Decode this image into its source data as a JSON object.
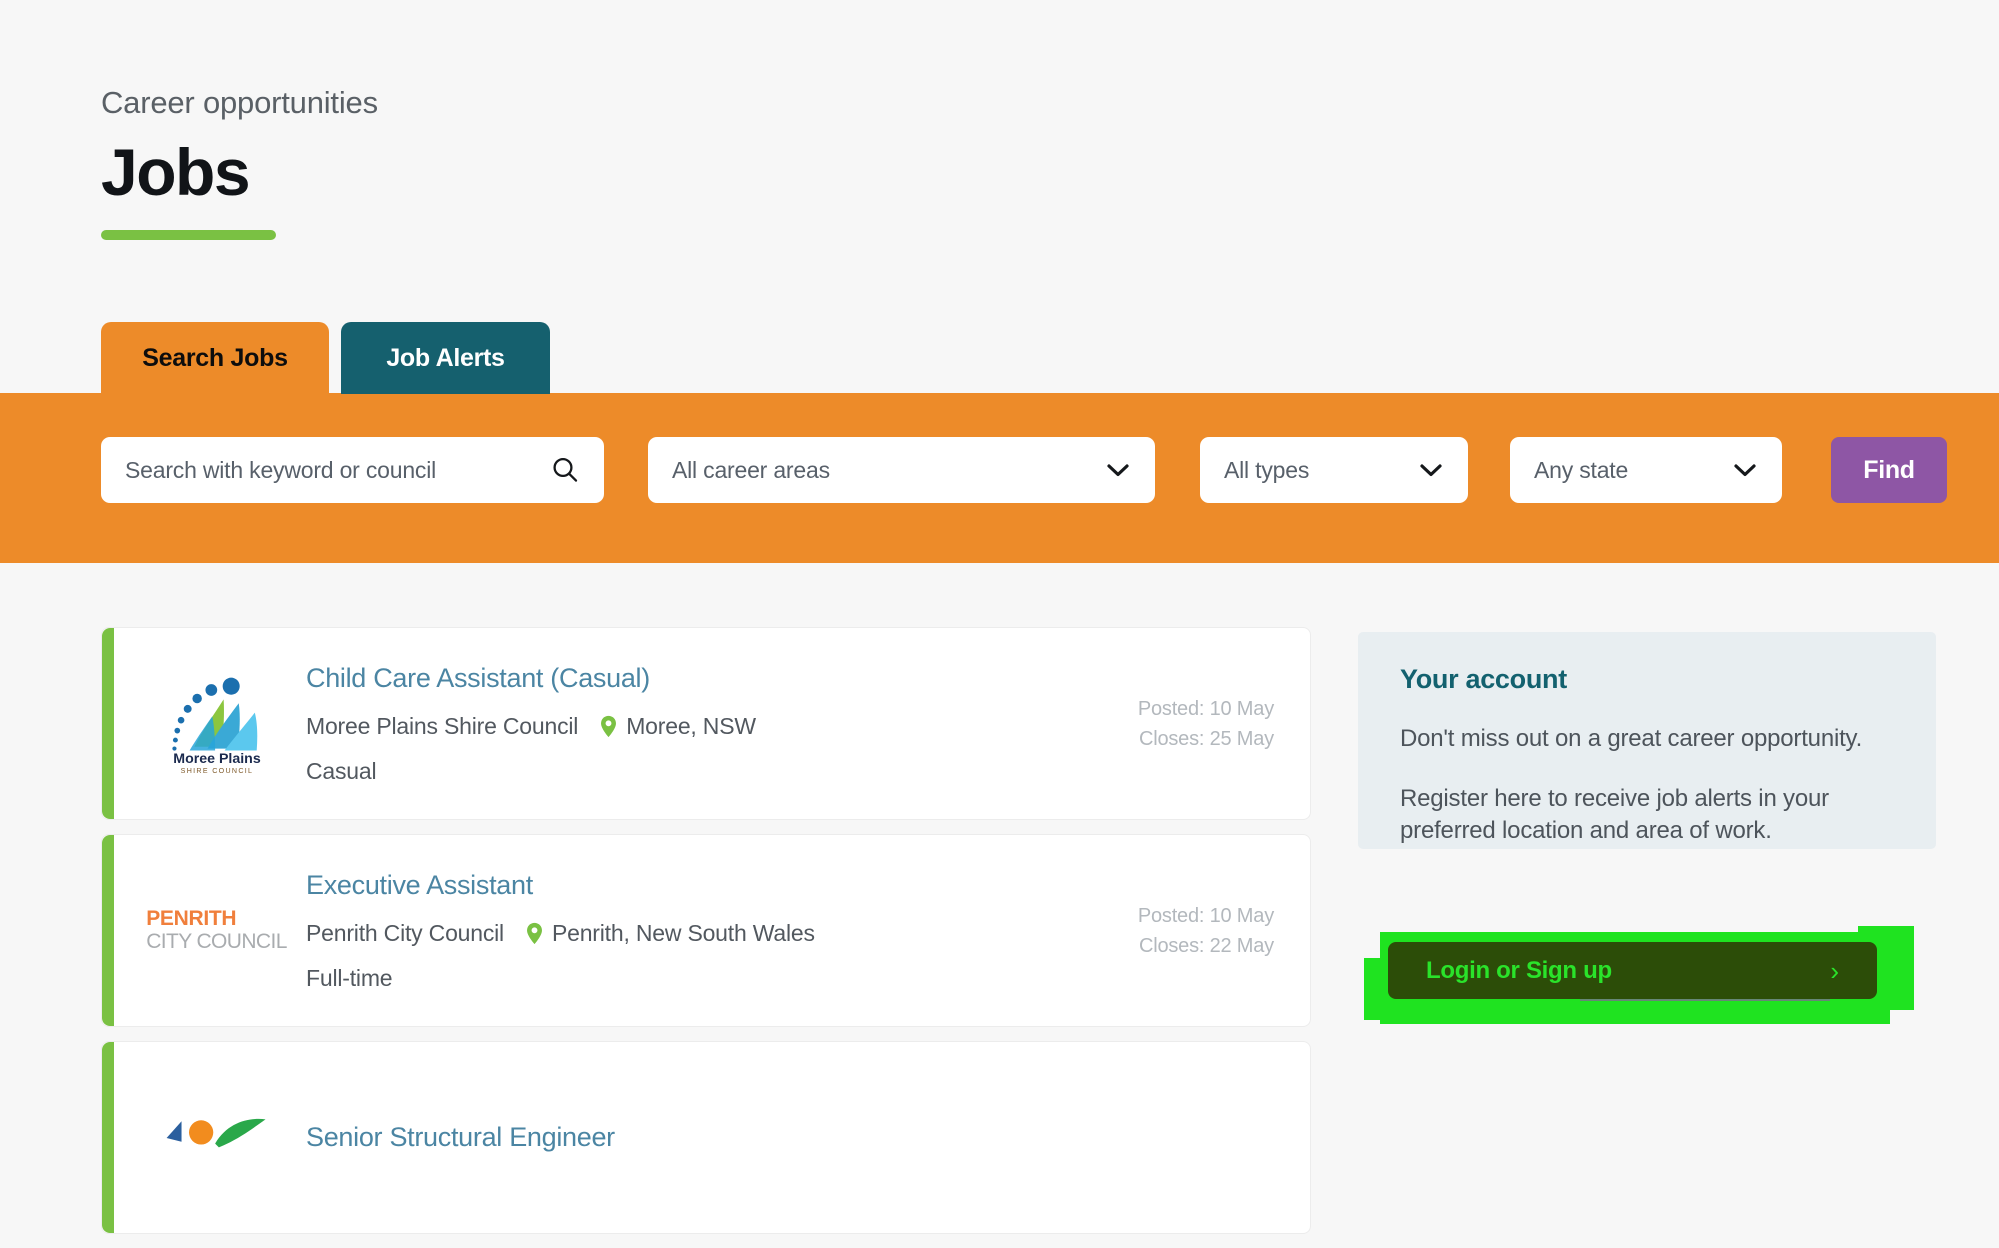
{
  "header": {
    "eyebrow": "Career opportunities",
    "title": "Jobs"
  },
  "tabs": [
    {
      "label": "Search Jobs",
      "active": true
    },
    {
      "label": "Job Alerts",
      "active": false
    }
  ],
  "search": {
    "keyword_placeholder": "Search with keyword or council",
    "keyword_value": "",
    "career_area": "All career areas",
    "job_type": "All types",
    "state": "Any state",
    "find_label": "Find",
    "icons": {
      "search": "search-icon",
      "chevron": "chevron-down-icon"
    }
  },
  "results": [
    {
      "title": "Child Care Assistant (Casual)",
      "employer": "Moree Plains Shire Council",
      "location": "Moree, NSW",
      "type": "Casual",
      "posted": "Posted: 10 May",
      "closes": "Closes: 25 May",
      "logo": "moree-plains-shire-council-logo",
      "logo_text_top": "Moree Plains",
      "logo_text_bottom": "SHIRE COUNCIL"
    },
    {
      "title": "Executive Assistant",
      "employer": "Penrith City Council",
      "location": "Penrith, New South Wales",
      "type": "Full-time",
      "posted": "Posted: 10 May",
      "closes": "Closes: 22 May",
      "logo": "penrith-city-council-logo",
      "logo_text_top": "PENRITH",
      "logo_text_bottom": "CITY COUNCIL"
    },
    {
      "title": "Senior Structural Engineer",
      "employer": "",
      "location": "",
      "type": "",
      "posted": "",
      "closes": "",
      "logo": "council-logo",
      "logo_text_top": "",
      "logo_text_bottom": ""
    }
  ],
  "account": {
    "title": "Your account",
    "paragraph_1": "Don't miss out on a great career opportunity.",
    "paragraph_2": "Register here to receive job alerts in your preferred location and area of work.",
    "login_label": "Login or Sign up",
    "login_chevron": "›"
  },
  "colors": {
    "page_background": "#f7f7f7",
    "band_orange": "#ed8b29",
    "tab_teal": "#15606e",
    "accent_green": "#7ac143",
    "find_purple": "#8e56a5",
    "job_title_blue": "#4b85a3",
    "panel_blue_grey": "#e8eef1",
    "heading_teal": "#13616f",
    "highlight_green": "#1fe320",
    "login_button_dark": "#2c4d08",
    "login_text_green": "#2ae32a"
  }
}
